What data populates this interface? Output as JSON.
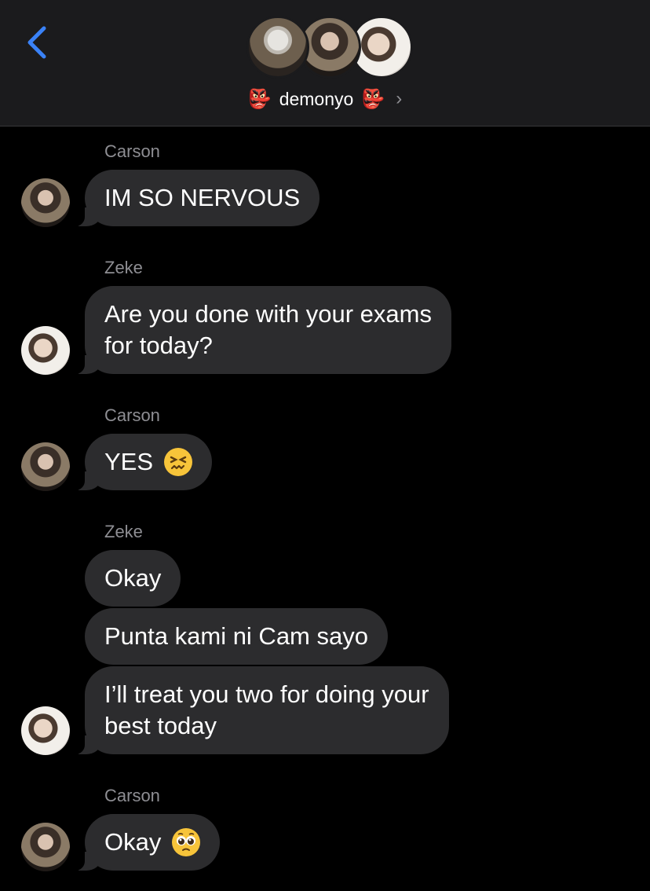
{
  "header": {
    "group_name": "demonyo",
    "name_emoji_left": "👺",
    "name_emoji_right": "👺",
    "chevron": "›",
    "back_icon": "chevron-left-icon",
    "accent": "#3a82f7"
  },
  "colors": {
    "background": "#000000",
    "header_bg": "#1b1b1d",
    "bubble_bg": "#2c2c2e",
    "sender_text": "#8e8e93"
  },
  "messages": [
    {
      "sender": "Carson",
      "text": "IM SO NERVOUS"
    },
    {
      "sender": "Zeke",
      "text": "Are you done with your exams\nfor today?"
    },
    {
      "sender": "Carson",
      "text": "YES",
      "emoji": "confounded-face-icon"
    },
    {
      "sender": "Zeke",
      "text": "Okay"
    },
    {
      "sender": "Zeke",
      "text": "Punta kami ni Cam sayo"
    },
    {
      "sender": "Zeke",
      "text": "I’ll treat you two for doing your\nbest today"
    },
    {
      "sender": "Carson",
      "text": "Okay",
      "emoji": "pleading-face-icon"
    }
  ]
}
